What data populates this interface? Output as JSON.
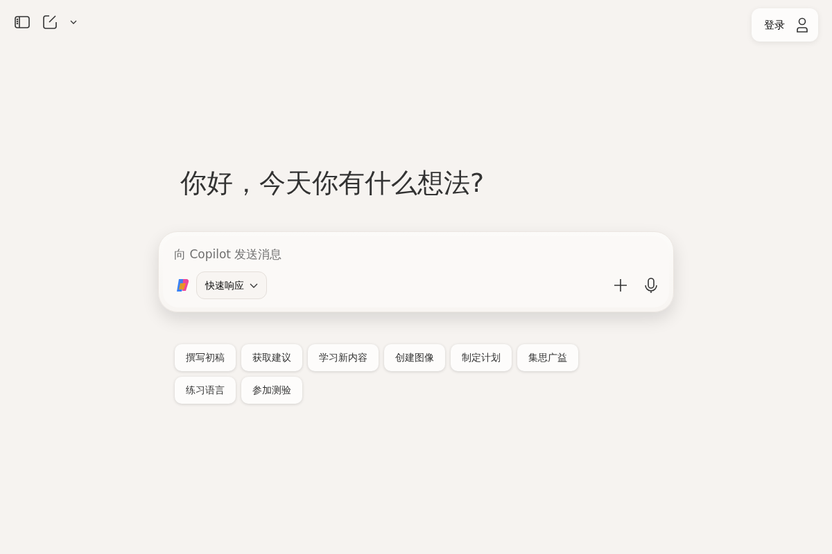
{
  "header": {
    "login_label": "登录"
  },
  "greeting": "你好，今天你有什么想法?",
  "composer": {
    "placeholder": "向 Copilot 发送消息",
    "mode_label": "快速响应"
  },
  "suggestions": [
    {
      "label": "撰写初稿"
    },
    {
      "label": "获取建议"
    },
    {
      "label": "学习新内容"
    },
    {
      "label": "创建图像"
    },
    {
      "label": "制定计划"
    },
    {
      "label": "集思广益"
    },
    {
      "label": "练习语言"
    },
    {
      "label": "参加测验"
    }
  ]
}
